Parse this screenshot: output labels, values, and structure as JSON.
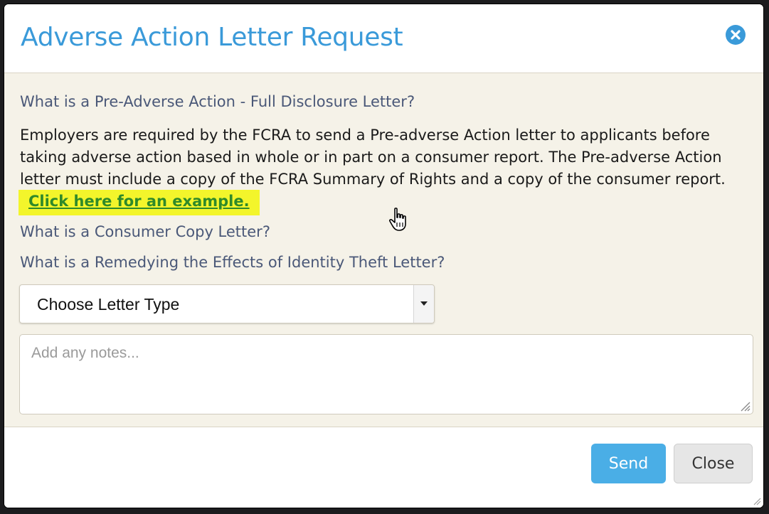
{
  "dialog": {
    "title": "Adverse Action Letter Request",
    "close_icon": "close-circle-icon",
    "accent_color": "#3a9ad9"
  },
  "faq": {
    "items": [
      {
        "question": "What is a Pre-Adverse Action - Full Disclosure Letter?",
        "answer": "Employers are required by the FCRA to send a Pre-adverse Action letter to applicants before taking adverse action based in whole or in part on a consumer report. The Pre-adverse Action letter must include a copy of the FCRA Summary of Rights and a copy of the consumer report.",
        "link_text": "Click here for an example."
      },
      {
        "question": "What is a Consumer Copy Letter?"
      },
      {
        "question": "What is a Remedying the Effects of Identity Theft Letter?"
      }
    ],
    "heading_color": "#4a5878",
    "link_highlight_color": "#f3f52b",
    "link_color": "#2f8a2a"
  },
  "form": {
    "letter_type": {
      "selected": "Choose Letter Type"
    },
    "notes": {
      "placeholder": "Add any notes...",
      "value": ""
    }
  },
  "footer": {
    "send_label": "Send",
    "close_label": "Close",
    "send_color": "#4aaee6"
  },
  "cursor": "hand-pointer-icon"
}
